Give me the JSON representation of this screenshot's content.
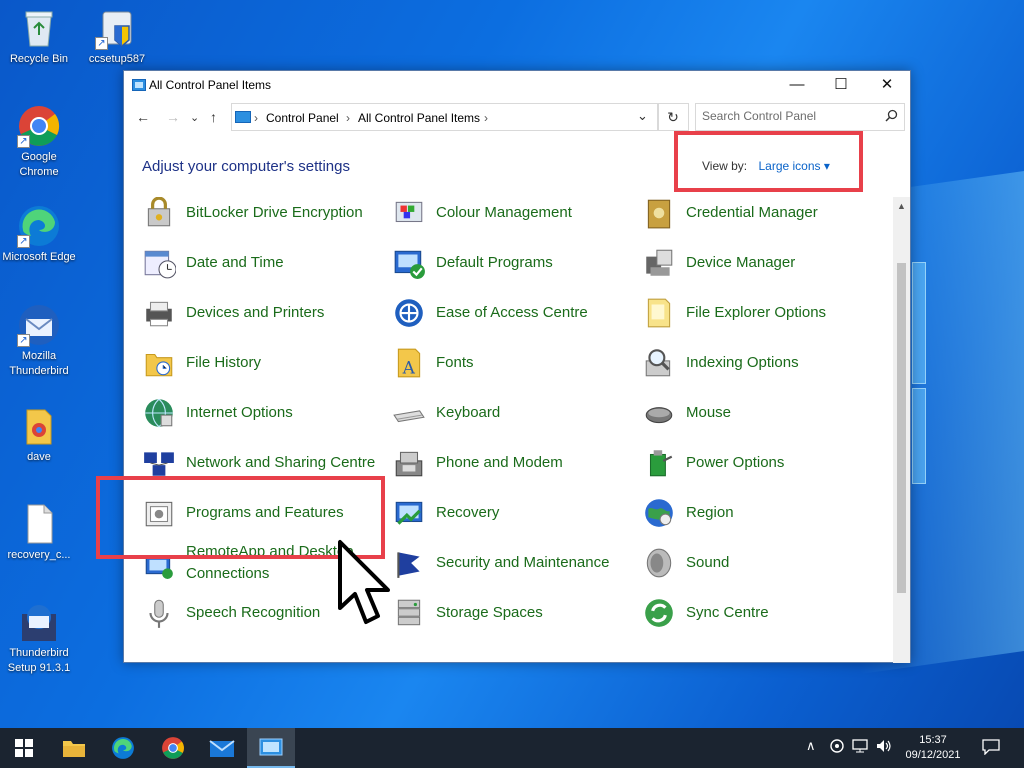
{
  "desktop": {
    "icons": [
      {
        "label": "Recycle Bin"
      },
      {
        "label": "ccsetup587"
      },
      {
        "label": "Google Chrome"
      },
      {
        "label": "Microsoft Edge"
      },
      {
        "label": "Mozilla Thunderbird"
      },
      {
        "label": "dave"
      },
      {
        "label": "recovery_c..."
      },
      {
        "label": "Thunderbird Setup 91.3.1"
      }
    ]
  },
  "window": {
    "title": "All Control Panel Items",
    "minimize": "—",
    "maximize": "☐",
    "close": "✕",
    "nav": {
      "back": "←",
      "forward": "→",
      "recent": "⌄",
      "up": "↑"
    },
    "breadcrumb": [
      "Control Panel",
      "All Control Panel Items"
    ],
    "breadcrumb_sep": "›",
    "dropdown": "⌄",
    "refresh": "↻",
    "search_placeholder": "Search Control Panel",
    "search_icon": "🔍",
    "heading": "Adjust your computer's settings",
    "view_by_label": "View by:",
    "view_by_value": "Large icons ▾"
  },
  "items": [
    {
      "label": "BitLocker Drive Encryption",
      "icon": "bitlocker-icon"
    },
    {
      "label": "Colour Management",
      "icon": "colour-management-icon"
    },
    {
      "label": "Credential Manager",
      "icon": "credential-manager-icon"
    },
    {
      "label": "Date and Time",
      "icon": "date-time-icon"
    },
    {
      "label": "Default Programs",
      "icon": "default-programs-icon"
    },
    {
      "label": "Device Manager",
      "icon": "device-manager-icon"
    },
    {
      "label": "Devices and Printers",
      "icon": "devices-printers-icon"
    },
    {
      "label": "Ease of Access Centre",
      "icon": "ease-of-access-icon"
    },
    {
      "label": "File Explorer Options",
      "icon": "file-explorer-options-icon"
    },
    {
      "label": "File History",
      "icon": "file-history-icon"
    },
    {
      "label": "Fonts",
      "icon": "fonts-icon"
    },
    {
      "label": "Indexing Options",
      "icon": "indexing-options-icon"
    },
    {
      "label": "Internet Options",
      "icon": "internet-options-icon"
    },
    {
      "label": "Keyboard",
      "icon": "keyboard-icon"
    },
    {
      "label": "Mouse",
      "icon": "mouse-icon"
    },
    {
      "label": "Network and Sharing Centre",
      "icon": "network-sharing-icon"
    },
    {
      "label": "Phone and Modem",
      "icon": "phone-modem-icon"
    },
    {
      "label": "Power Options",
      "icon": "power-options-icon"
    },
    {
      "label": "Programs and Features",
      "icon": "programs-features-icon"
    },
    {
      "label": "Recovery",
      "icon": "recovery-icon"
    },
    {
      "label": "Region",
      "icon": "region-icon"
    },
    {
      "label": "RemoteApp and Desktop Connections",
      "icon": "remoteapp-icon"
    },
    {
      "label": "Security and Maintenance",
      "icon": "security-maintenance-icon"
    },
    {
      "label": "Sound",
      "icon": "sound-icon"
    },
    {
      "label": "Speech Recognition",
      "icon": "speech-recognition-icon"
    },
    {
      "label": "Storage Spaces",
      "icon": "storage-spaces-icon"
    },
    {
      "label": "Sync Centre",
      "icon": "sync-centre-icon"
    }
  ],
  "taskbar": {
    "clock_time": "15:37",
    "clock_date": "09/12/2021",
    "tray_chevron": "∧"
  },
  "colors": {
    "item_text": "#1a6b1a",
    "heading": "#1e3287",
    "link": "#0a63c9",
    "highlight_box": "#e8404a",
    "taskbar": "#1b2430"
  }
}
